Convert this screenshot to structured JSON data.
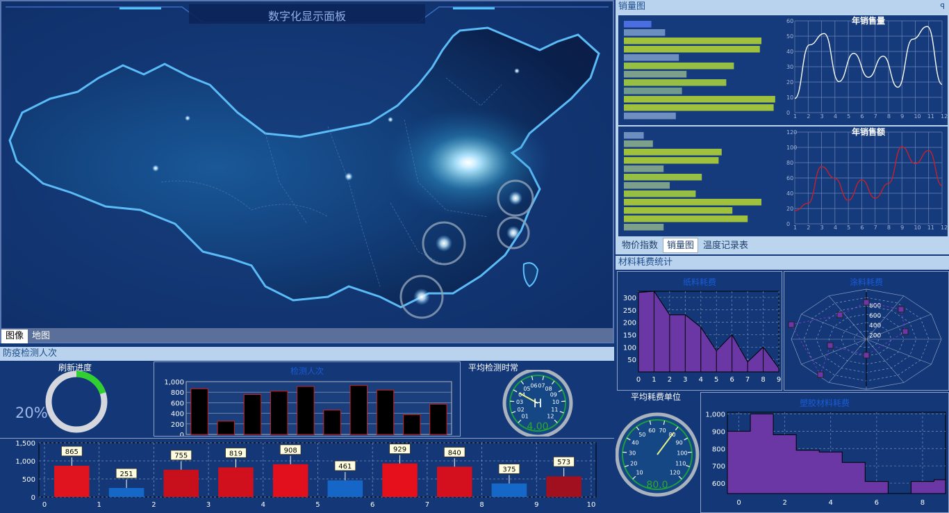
{
  "map_panel": {
    "title": "数字化显示面板",
    "tabs": [
      "图像",
      "地图"
    ],
    "active_tab": 0
  },
  "epidemic": {
    "header": "防疫检测人次",
    "refresh": {
      "label": "刷新进度",
      "percent_text": "20%",
      "progress": 0.2
    },
    "avg_time": {
      "label": "平均检测时常",
      "center": "H",
      "value": "4.00",
      "ticks": [
        "01",
        "02",
        "03",
        "04",
        "05",
        "06",
        "07",
        "08",
        "09",
        "10",
        "11",
        "12"
      ],
      "needle": 4.0
    },
    "count_chart": {
      "title": "检测人次",
      "y_ticks": [
        "1,000",
        "800",
        "600",
        "400",
        "200",
        "0"
      ],
      "ylim": [
        0,
        1000
      ],
      "values": [
        865,
        251,
        755,
        819,
        908,
        461,
        929,
        840,
        375,
        573
      ]
    },
    "bottom_chart": {
      "y_ticks": [
        "1,500",
        "1,000",
        "500",
        "0"
      ],
      "ylim": [
        0,
        1500
      ],
      "x_ticks": [
        "0",
        "1",
        "2",
        "3",
        "4",
        "5",
        "6",
        "7",
        "8",
        "9",
        "10"
      ],
      "values": [
        865,
        251,
        755,
        819,
        908,
        461,
        929,
        840,
        375,
        573
      ],
      "labels": [
        "865",
        "251",
        "755",
        "819",
        "908",
        "461",
        "929",
        "840",
        "375",
        "573"
      ],
      "colors": [
        "#e0141e",
        "#1568c8",
        "#c8101c",
        "#d1101e",
        "#e2101c",
        "#1566c6",
        "#e5101c",
        "#d5101e",
        "#1568c8",
        "#a0101e"
      ]
    }
  },
  "sales": {
    "header": "销量图",
    "pin": "ꟼ",
    "quantity": {
      "title": "年销售量",
      "bars": [
        0.18,
        0.27,
        0.9,
        0.89,
        0.36,
        0.72,
        0.41,
        0.67,
        0.38,
        0.99,
        0.98,
        0.34
      ],
      "bar_colors": [
        "#4a6de0",
        "#6c8fc0",
        "#9fc13c",
        "#9fc13c",
        "#6c8fc0",
        "#96bf44",
        "#7da08a",
        "#96bf44",
        "#6f9a8e",
        "#9fc13c",
        "#9fc13c",
        "#6f8fc0"
      ],
      "y_ticks": [
        "60",
        "50",
        "40",
        "30",
        "20",
        "10",
        "0"
      ],
      "x_ticks": [
        "1",
        "2",
        "3",
        "4",
        "5",
        "6",
        "7",
        "8",
        "9",
        "10",
        "11",
        "12"
      ],
      "line": [
        10,
        48,
        56,
        22,
        42,
        25,
        40,
        18,
        52,
        61,
        20
      ]
    },
    "amount": {
      "title": "年销售额",
      "bars": [
        0.13,
        0.19,
        0.64,
        0.62,
        0.26,
        0.51,
        0.3,
        0.47,
        0.9,
        0.71,
        0.81,
        0.26
      ],
      "bar_colors": [
        "#6c8fc0",
        "#7da08a",
        "#9fc13c",
        "#9fc13c",
        "#7da08a",
        "#96bf44",
        "#7da08a",
        "#96bf44",
        "#9fc13c",
        "#9fc13c",
        "#9fc13c",
        "#7da08a"
      ],
      "y_ticks": [
        "120",
        "100",
        "80",
        "60",
        "40",
        "20",
        "0"
      ],
      "x_ticks": [
        "1",
        "2",
        "3",
        "4",
        "5",
        "6",
        "7",
        "8",
        "9",
        "10",
        "11",
        "12"
      ],
      "line": [
        18,
        28,
        78,
        62,
        32,
        60,
        35,
        55,
        105,
        82,
        100,
        52
      ]
    },
    "tabs": [
      "物价指数",
      "销量图",
      "温度记录表"
    ],
    "active_tab": 1
  },
  "materials": {
    "header": "材料耗费统计",
    "fabric": {
      "title": "纸料耗费",
      "y_ticks": [
        "300",
        "250",
        "200",
        "150",
        "100",
        "50"
      ],
      "x_ticks": [
        "0",
        "1",
        "2",
        "3",
        "4",
        "5",
        "6",
        "7",
        "8",
        "9"
      ],
      "ylim": [
        0,
        325
      ],
      "xlim": [
        0,
        9
      ],
      "values": [
        320,
        330,
        230,
        230,
        180,
        85,
        150,
        40,
        100,
        15
      ]
    },
    "paint": {
      "title": "涂料耗费",
      "rings": [
        "800",
        "600",
        "400",
        "200"
      ]
    },
    "avg_unit": {
      "label": "平均耗费单位",
      "value": "80.0",
      "ticks": [
        "10",
        "20",
        "30",
        "40",
        "50",
        "60",
        "70",
        "80",
        "90",
        "100",
        "110",
        "120"
      ]
    },
    "plastic": {
      "title": "塑胶材料耗费",
      "y_ticks": [
        "1,000",
        "900",
        "800",
        "700",
        "600"
      ],
      "x_ticks": [
        "0",
        "2",
        "4",
        "6",
        "8"
      ],
      "ylim": [
        540,
        1010
      ],
      "steps": [
        900,
        1000,
        880,
        790,
        780,
        720,
        610,
        540,
        610,
        620
      ]
    }
  }
}
